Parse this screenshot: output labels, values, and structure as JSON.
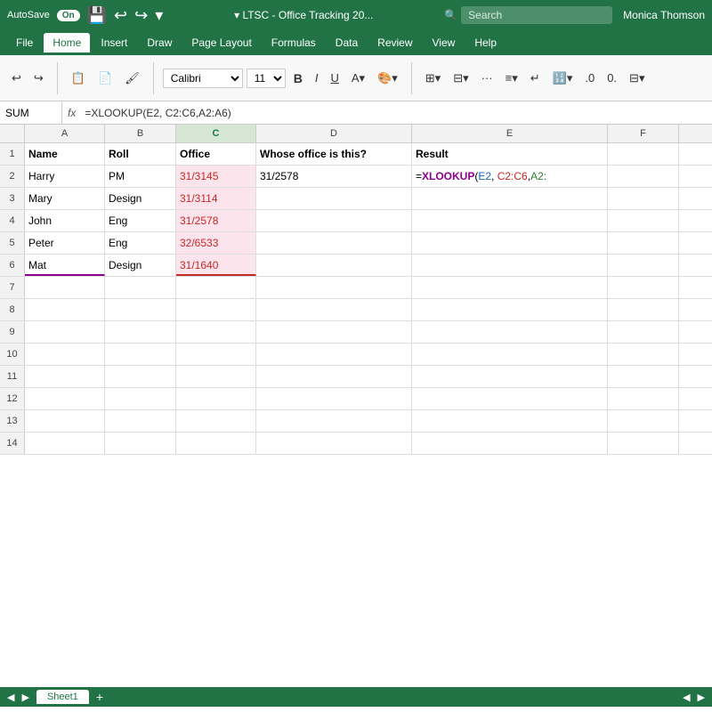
{
  "titleBar": {
    "autosave_label": "AutoSave",
    "autosave_on": "On",
    "title": "LTSC - Office Tracking 20...",
    "search_placeholder": "Search",
    "user": "Monica Thomson"
  },
  "ribbonTabs": {
    "tabs": [
      "File",
      "Home",
      "Insert",
      "Draw",
      "Page Layout",
      "Formulas",
      "Data",
      "Review",
      "View",
      "Help"
    ],
    "active": "Home"
  },
  "ribbon": {
    "font": "Calibri",
    "font_size": "11",
    "bold": "B"
  },
  "formulaBar": {
    "cell_ref": "SUM",
    "fx_label": "fx",
    "formula": "=XLOOKUP(E2, C2:C6,A2:A6)"
  },
  "columns": {
    "headers": [
      "A",
      "B",
      "C",
      "D",
      "E",
      "F"
    ]
  },
  "rows": [
    {
      "num": "1",
      "cells": [
        "Name",
        "Roll",
        "Office",
        "Whose office is this?",
        "Result",
        ""
      ]
    },
    {
      "num": "2",
      "cells": [
        "Harry",
        "PM",
        "31/3145",
        "31/2578",
        "=XLOOKUP(E2, C2:C6,A2:",
        ""
      ]
    },
    {
      "num": "3",
      "cells": [
        "Mary",
        "Design",
        "31/3114",
        "",
        "",
        ""
      ]
    },
    {
      "num": "4",
      "cells": [
        "John",
        "Eng",
        "31/2578",
        "",
        "",
        ""
      ]
    },
    {
      "num": "5",
      "cells": [
        "Peter",
        "Eng",
        "32/6533",
        "",
        "",
        ""
      ]
    },
    {
      "num": "6",
      "cells": [
        "Mat",
        "Design",
        "31/1640",
        "",
        "",
        ""
      ]
    },
    {
      "num": "7",
      "cells": [
        "",
        "",
        "",
        "",
        "",
        ""
      ]
    },
    {
      "num": "8",
      "cells": [
        "",
        "",
        "",
        "",
        "",
        ""
      ]
    },
    {
      "num": "9",
      "cells": [
        "",
        "",
        "",
        "",
        "",
        ""
      ]
    },
    {
      "num": "10",
      "cells": [
        "",
        "",
        "",
        "",
        "",
        ""
      ]
    },
    {
      "num": "11",
      "cells": [
        "",
        "",
        "",
        "",
        "",
        ""
      ]
    },
    {
      "num": "12",
      "cells": [
        "",
        "",
        "",
        "",
        "",
        ""
      ]
    },
    {
      "num": "13",
      "cells": [
        "",
        "",
        "",
        "",
        "",
        ""
      ]
    },
    {
      "num": "14",
      "cells": [
        "",
        "",
        "",
        "",
        "",
        ""
      ]
    }
  ],
  "statusBar": {
    "sheet_tab": "Sheet1",
    "add_icon": "+"
  }
}
